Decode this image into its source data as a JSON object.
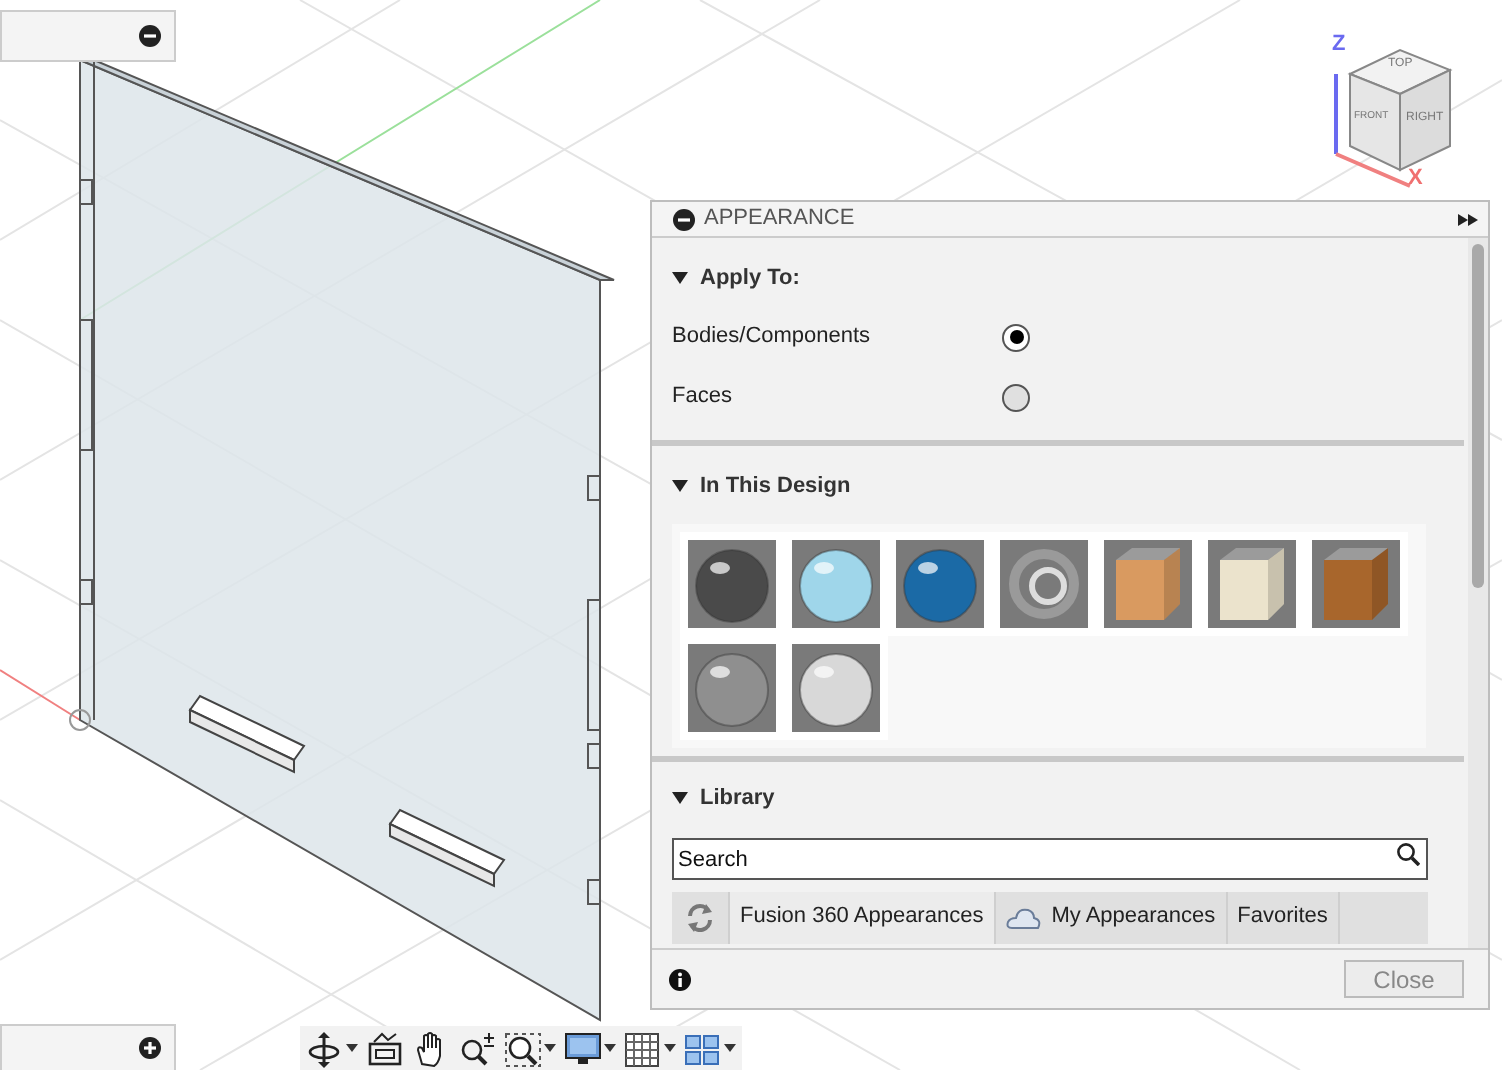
{
  "browser_panel": {
    "expanded": true
  },
  "comments_panel": {
    "expanded": false
  },
  "viewcube": {
    "faces": [
      "TOP",
      "FRONT",
      "RIGHT"
    ],
    "axes": [
      "Z",
      "X"
    ]
  },
  "appearance_panel": {
    "title": "APPEARANCE",
    "apply_to": {
      "heading": "Apply To:",
      "expanded": true,
      "options": [
        {
          "label": "Bodies/Components",
          "selected": true
        },
        {
          "label": "Faces",
          "selected": false
        }
      ]
    },
    "in_this_design": {
      "heading": "In This Design",
      "expanded": true,
      "swatches": [
        {
          "kind": "sphere",
          "color": "#4a4a4a"
        },
        {
          "kind": "sphere",
          "color": "#9fd6ea"
        },
        {
          "kind": "sphere",
          "color": "#1b6aa6"
        },
        {
          "kind": "ring",
          "color": "#9a9a9a"
        },
        {
          "kind": "cube",
          "color": "#d99a60"
        },
        {
          "kind": "cube",
          "color": "#ebe3cc"
        },
        {
          "kind": "cube",
          "color": "#a8662c"
        },
        {
          "kind": "sphere",
          "color": "#8f8f8f"
        },
        {
          "kind": "sphere",
          "color": "#d8d8d8"
        }
      ]
    },
    "library": {
      "heading": "Library",
      "expanded": true,
      "search": {
        "placeholder": "Search"
      },
      "tabs": [
        {
          "kind": "plain",
          "label": "Fusion 360 Appearances",
          "selected": true
        },
        {
          "kind": "cloud",
          "label": "My Appearances",
          "selected": false
        },
        {
          "kind": "plain",
          "label": "Favorites",
          "selected": false
        }
      ]
    },
    "close_button": {
      "label": "Close",
      "disabled": true
    }
  },
  "toolbar": [
    {
      "kind": "orbit",
      "menu": true
    },
    {
      "kind": "look-at",
      "menu": false
    },
    {
      "kind": "pan",
      "menu": false
    },
    {
      "kind": "zoom",
      "menu": false
    },
    {
      "kind": "fit",
      "menu": true
    },
    {
      "kind": "display",
      "menu": true
    },
    {
      "kind": "grid",
      "menu": true
    },
    {
      "kind": "viewports",
      "menu": true
    }
  ]
}
